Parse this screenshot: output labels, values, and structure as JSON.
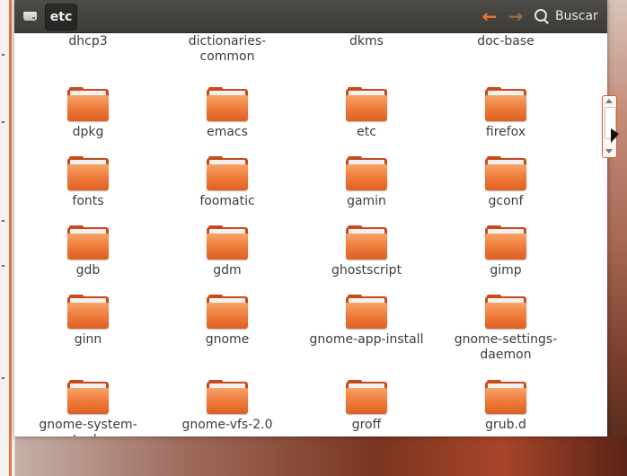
{
  "window": {
    "breadcrumb": {
      "current": "etc"
    },
    "search": {
      "label": "Buscar"
    }
  },
  "colors": {
    "accent": "#ef7a2f",
    "folder": "#ef7f3e",
    "titlebar": "#3d3c38"
  },
  "icons": {
    "drive": "drive-icon",
    "back": "arrow-left-icon",
    "forward": "arrow-right-icon",
    "search": "search-icon",
    "folder": "folder-icon"
  },
  "folders": [
    [
      "dhcp3",
      "dictionaries-\ncommon",
      "dkms",
      "doc-base"
    ],
    [
      "dpkg",
      "emacs",
      "etc",
      "firefox"
    ],
    [
      "fonts",
      "foomatic",
      "gamin",
      "gconf"
    ],
    [
      "gdb",
      "gdm",
      "ghostscript",
      "gimp"
    ],
    [
      "ginn",
      "gnome",
      "gnome-app-install",
      "gnome-settings-\ndaemon"
    ],
    [
      "gnome-system-\ntools",
      "gnome-vfs-2.0",
      "groff",
      "grub.d"
    ]
  ]
}
